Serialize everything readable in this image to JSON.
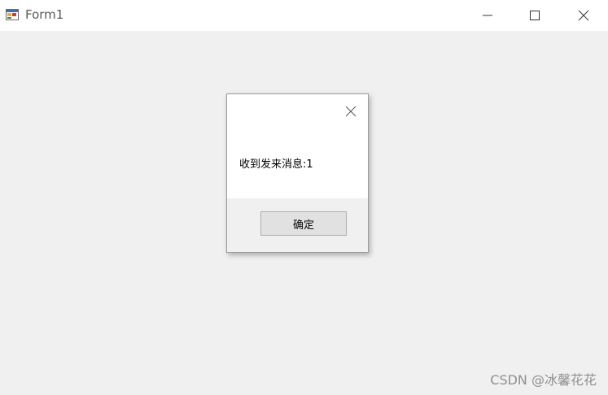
{
  "window": {
    "title": "Form1",
    "icon": "winforms-app-icon",
    "controls": {
      "minimize_icon": "minimize-icon",
      "maximize_icon": "maximize-icon",
      "close_icon": "close-icon"
    }
  },
  "messagebox": {
    "message": "收到发来消息:1",
    "ok_label": "确定",
    "close_icon": "close-icon"
  },
  "watermark": {
    "text": "CSDN @冰馨花花"
  },
  "colors": {
    "titlebar": "#ffffff",
    "client_bg": "#f0f0f0",
    "button_bg": "#e1e1e1",
    "button_border": "#adadad"
  }
}
